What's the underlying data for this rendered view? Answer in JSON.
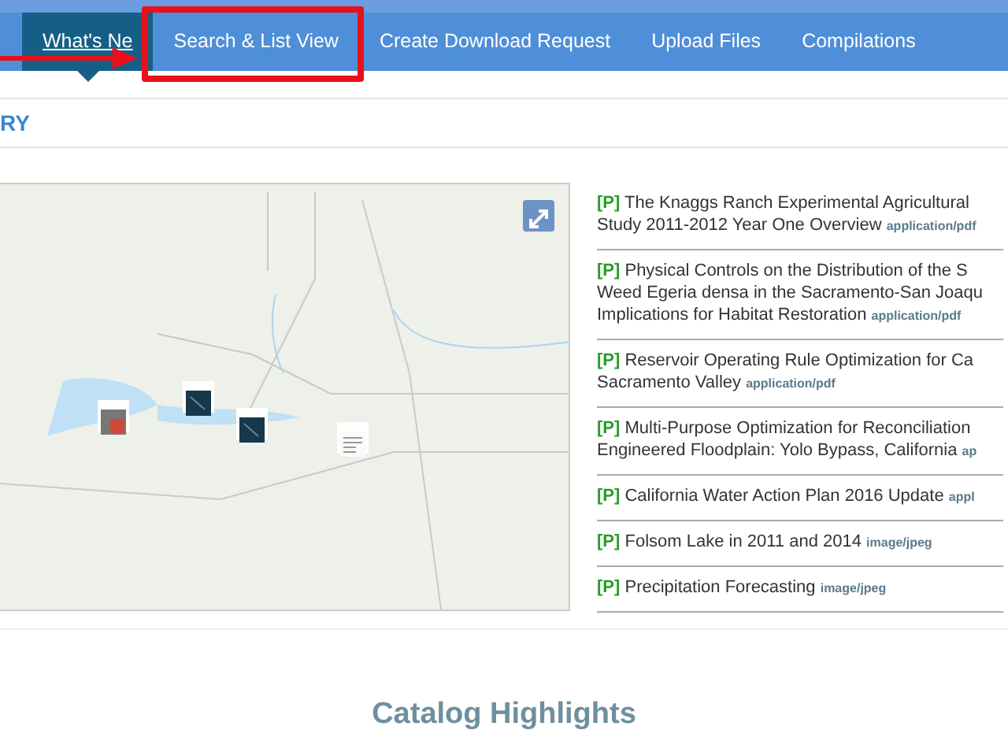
{
  "nav": {
    "tabs": [
      {
        "label": "What's Ne",
        "selected": true,
        "highlighted": false
      },
      {
        "label": "Search & List View",
        "selected": false,
        "highlighted": true
      },
      {
        "label": "Create Download Request",
        "selected": false,
        "highlighted": false
      },
      {
        "label": "Upload Files",
        "selected": false,
        "highlighted": false
      },
      {
        "label": "Compilations",
        "selected": false,
        "highlighted": false
      }
    ]
  },
  "annotation": {
    "kind": "arrow-box"
  },
  "section": {
    "title": "RY"
  },
  "map": {
    "markers": [
      {
        "kind": "photo"
      },
      {
        "kind": "dark"
      },
      {
        "kind": "dark"
      },
      {
        "kind": "document"
      }
    ]
  },
  "items": [
    {
      "tag": "[P]",
      "lines": [
        "The Knaggs Ranch Experimental Agricultural",
        "Study 2011-2012 Year One Overview"
      ],
      "mime": "application/pdf"
    },
    {
      "tag": "[P]",
      "lines": [
        "Physical Controls on the Distribution of the S",
        "Weed Egeria densa in the Sacramento-San Joaqu",
        "Implications for Habitat Restoration"
      ],
      "mime": "application/pdf"
    },
    {
      "tag": "[P]",
      "lines": [
        "Reservoir Operating Rule Optimization for Ca",
        "Sacramento Valley"
      ],
      "mime": "application/pdf"
    },
    {
      "tag": "[P]",
      "lines": [
        "Multi-Purpose Optimization for Reconciliation",
        "Engineered Floodplain: Yolo Bypass, California"
      ],
      "mime": "ap"
    },
    {
      "tag": "[P]",
      "lines": [
        "California Water Action Plan 2016 Update"
      ],
      "mime": "appl"
    },
    {
      "tag": "[P]",
      "lines": [
        "Folsom Lake in 2011 and 2014"
      ],
      "mime": "image/jpeg"
    },
    {
      "tag": "[P]",
      "lines": [
        "Precipitation Forecasting"
      ],
      "mime": "image/jpeg"
    }
  ],
  "highlights": {
    "title": "Catalog Highlights"
  }
}
